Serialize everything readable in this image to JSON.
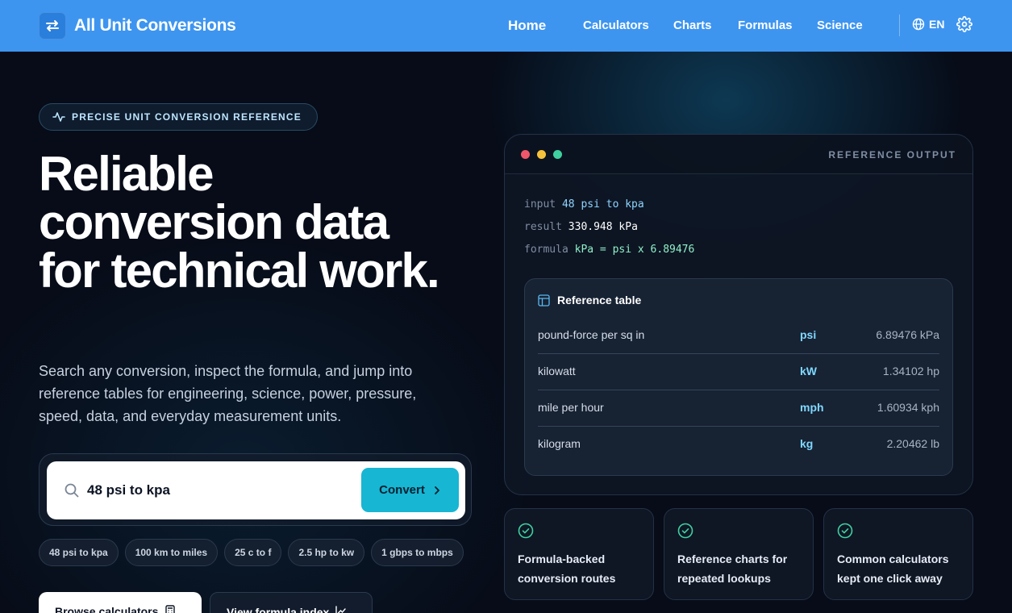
{
  "brand": {
    "name": "All Unit Conversions"
  },
  "nav": {
    "items": [
      {
        "label": "Home"
      },
      {
        "label": "Calculators"
      },
      {
        "label": "Charts"
      },
      {
        "label": "Formulas"
      },
      {
        "label": "Science"
      }
    ],
    "language": "EN"
  },
  "hero": {
    "badge": "PRECISE UNIT CONVERSION REFERENCE",
    "title": "Reliable conversion data for technical work.",
    "subtitle": "Search any conversion, inspect the formula, and jump into reference tables for engineering, science, power, pressure, speed, data, and everyday measurement units.",
    "search": {
      "value": "48 psi to kpa",
      "button": "Convert"
    },
    "chips": [
      "48 psi to kpa",
      "100 km to miles",
      "25 c to f",
      "2.5 hp to kw",
      "1 gbps to mbps"
    ],
    "cta": {
      "primary": "Browse calculators",
      "secondary": "View formula index"
    }
  },
  "panel": {
    "label": "REFERENCE OUTPUT",
    "lines": [
      {
        "key": "input",
        "value": "48 psi to kpa"
      },
      {
        "key": "result",
        "value": "330.948 kPa"
      },
      {
        "key": "formula",
        "value": "kPa = psi x 6.89476"
      }
    ],
    "table": {
      "title": "Reference table",
      "rows": [
        {
          "name": "pound-force per sq in",
          "symbol": "psi",
          "value": "6.89476 kPa"
        },
        {
          "name": "kilowatt",
          "symbol": "kW",
          "value": "1.34102 hp"
        },
        {
          "name": "mile per hour",
          "symbol": "mph",
          "value": "1.60934 kph"
        },
        {
          "name": "kilogram",
          "symbol": "kg",
          "value": "2.20462 lb"
        }
      ]
    }
  },
  "features": [
    {
      "text": "Formula-backed conversion routes"
    },
    {
      "text": "Reference charts for repeated lookups"
    },
    {
      "text": "Common calculators kept one click away"
    }
  ],
  "colors": {
    "nav": "#3d95f0",
    "accent": "#17b6d3",
    "background": "#070c18",
    "check": "#3fd0a0"
  }
}
